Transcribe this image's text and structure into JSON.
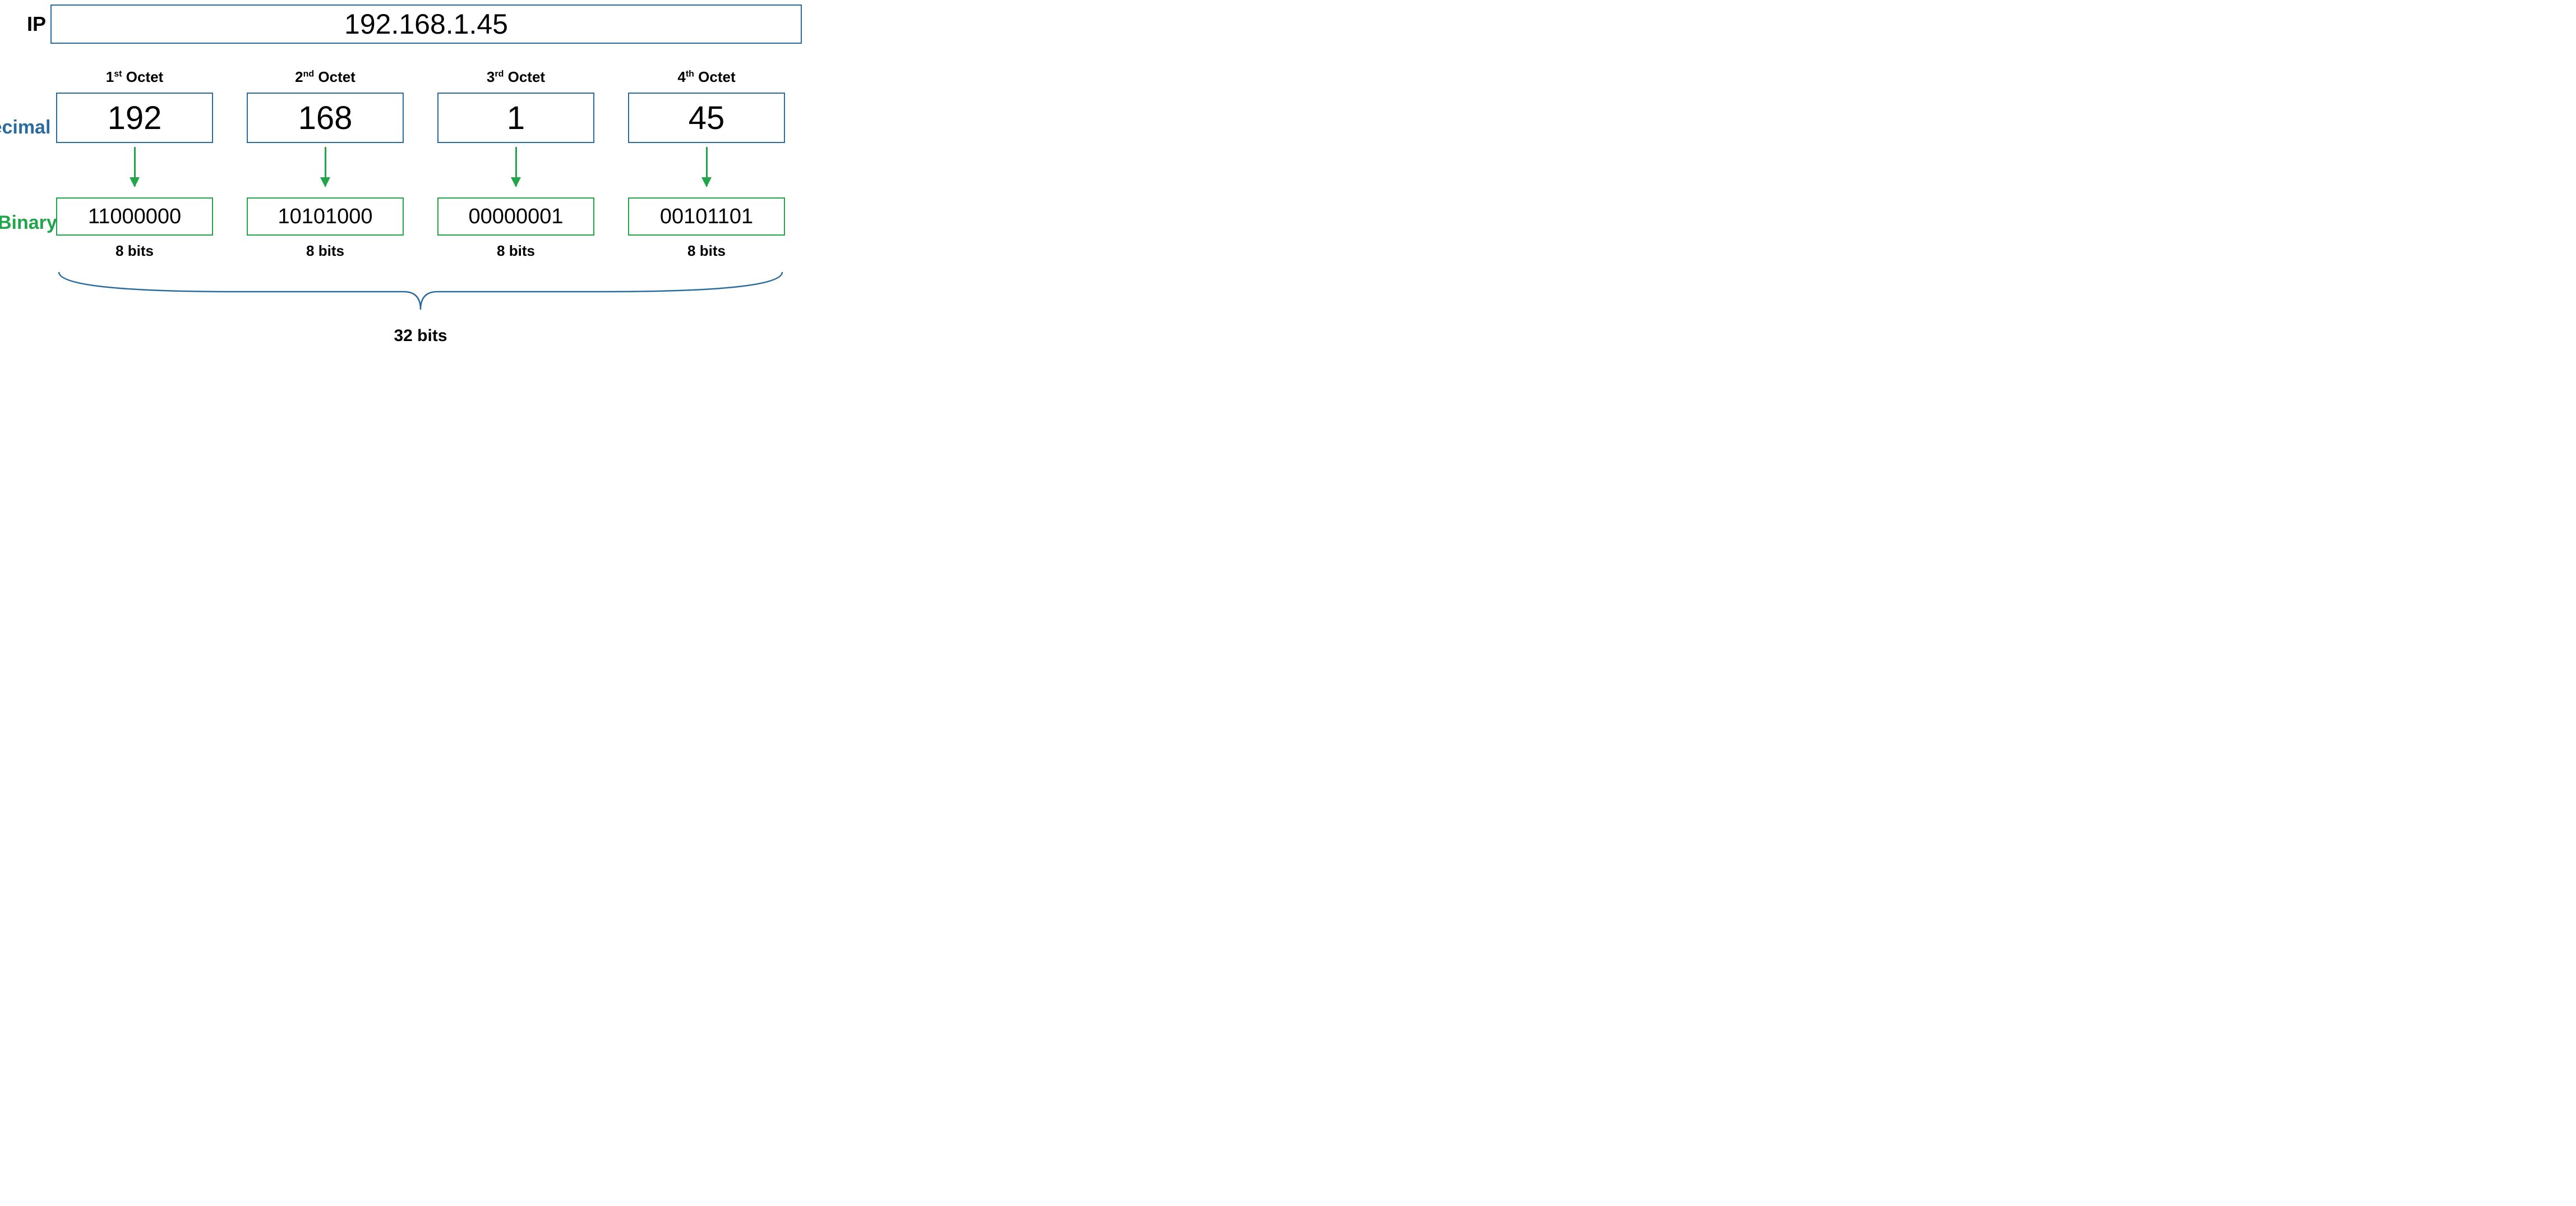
{
  "labels": {
    "ip": "IP",
    "decimal": "Decimal",
    "binary": "Binary"
  },
  "ip_address": "192.168.1.45",
  "octets": [
    {
      "title_num": "1",
      "title_suffix": "st",
      "title_word": " Octet",
      "decimal": "192",
      "binary": "11000000",
      "bits": "8 bits"
    },
    {
      "title_num": "2",
      "title_suffix": "nd",
      "title_word": " Octet",
      "decimal": "168",
      "binary": "10101000",
      "bits": "8 bits"
    },
    {
      "title_num": "3",
      "title_suffix": "rd",
      "title_word": " Octet",
      "decimal": "1",
      "binary": "00000001",
      "bits": "8 bits"
    },
    {
      "title_num": "4",
      "title_suffix": "th",
      "title_word": " Octet",
      "decimal": "45",
      "binary": "00101101",
      "bits": "8 bits"
    }
  ],
  "total_bits": "32 bits",
  "colors": {
    "blue": "#2b6c9e",
    "green": "#21a54a"
  }
}
